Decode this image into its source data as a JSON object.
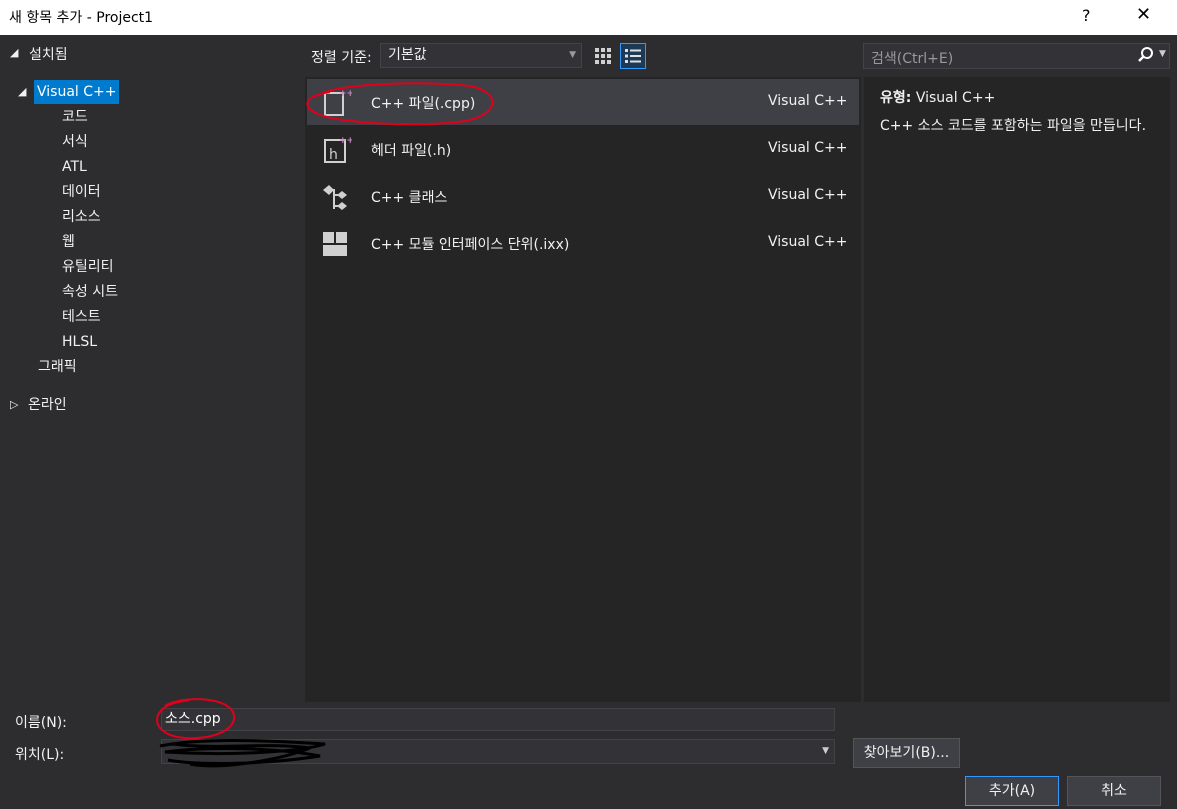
{
  "window": {
    "title": "새 항목 추가 - Project1",
    "help": "?",
    "close": "✕"
  },
  "left_panel": {
    "header": "설치됨",
    "tree": [
      {
        "label": "Visual C++",
        "selected": true
      },
      {
        "label": "코드"
      },
      {
        "label": "서식"
      },
      {
        "label": "ATL"
      },
      {
        "label": "데이터"
      },
      {
        "label": "리소스"
      },
      {
        "label": "웹"
      },
      {
        "label": "유틸리티"
      },
      {
        "label": "속성 시트"
      },
      {
        "label": "테스트"
      },
      {
        "label": "HLSL"
      },
      {
        "label": "그래픽"
      },
      {
        "label": "온라인"
      }
    ]
  },
  "toolbar": {
    "sort_label": "정렬 기준:",
    "sort_value": "기본값",
    "view_grid_icon": "grid-view-icon",
    "view_list_icon": "list-view-icon"
  },
  "search": {
    "placeholder": "검색(Ctrl+E)",
    "icon": "search-icon"
  },
  "templates": [
    {
      "name": "C++ 파일(.cpp)",
      "type": "Visual C++",
      "icon": "cpp-file-icon",
      "selected": true
    },
    {
      "name": "헤더 파일(.h)",
      "type": "Visual C++",
      "icon": "header-file-icon"
    },
    {
      "name": "C++ 클래스",
      "type": "Visual C++",
      "icon": "class-icon"
    },
    {
      "name": "C++ 모듈 인터페이스 단위(.ixx)",
      "type": "Visual C++",
      "icon": "module-icon"
    }
  ],
  "description": {
    "type_label": "유형:",
    "type_value": "Visual C++",
    "text": "C++ 소스 코드를 포함하는 파일을 만듭니다."
  },
  "form": {
    "name_label": "이름(N):",
    "name_value": "소스.cpp",
    "location_label": "위치(L):",
    "location_value": "",
    "browse_label": "찾아보기(B)...",
    "add_label": "추가(A)",
    "cancel_label": "취소"
  },
  "colors": {
    "accent": "#007acc",
    "background": "#2d2d30",
    "panel": "#252526",
    "annotation": "#e0001b"
  }
}
